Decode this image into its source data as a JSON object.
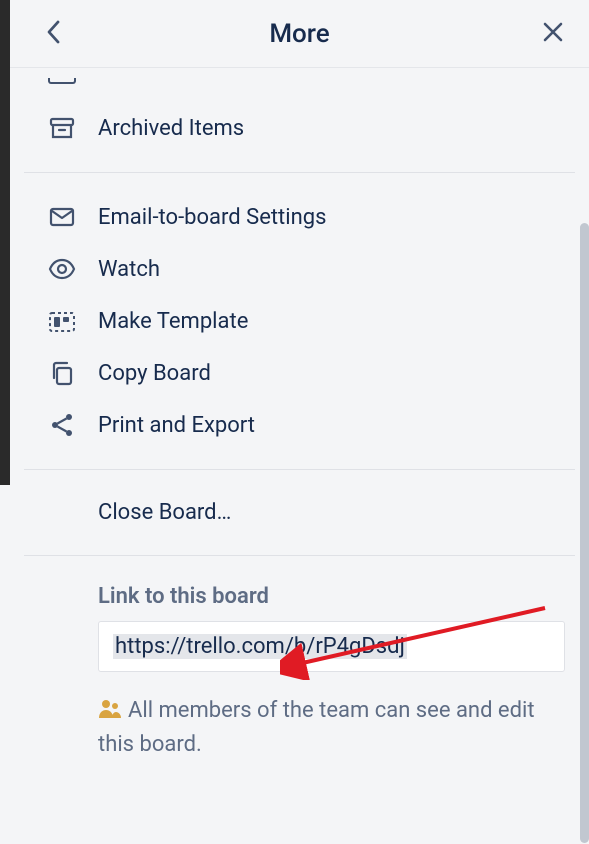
{
  "header": {
    "title": "More"
  },
  "menu": {
    "archived": "Archived Items",
    "email": "Email-to-board Settings",
    "watch": "Watch",
    "template": "Make Template",
    "copy": "Copy Board",
    "print": "Print and Export",
    "close_board": "Close Board…"
  },
  "link_section": {
    "heading": "Link to this board",
    "url": "https://trello.com/b/rP4gDsdj",
    "team_note": "All members of the team can see and edit this board."
  },
  "colors": {
    "arrow": "#e01b24",
    "team_icon": "#d9a441"
  }
}
